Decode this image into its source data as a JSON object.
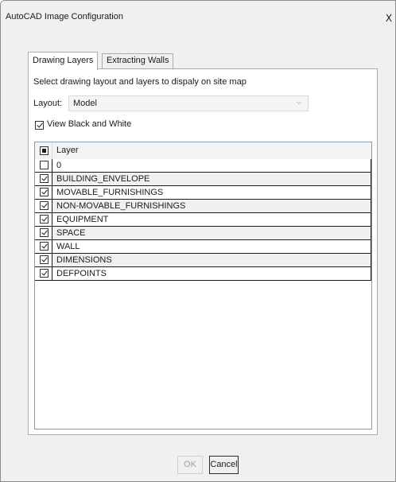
{
  "window": {
    "title": "AutoCAD Image Configuration",
    "close_label": "X"
  },
  "tabs": [
    {
      "label": "Drawing Layers",
      "active": true
    },
    {
      "label": "Extracting Walls",
      "active": false
    }
  ],
  "panel": {
    "instruction": "Select drawing layout and layers to dispaly on site map",
    "layout_label": "Layout:",
    "layout_value": "Model",
    "view_bw_label": "View Black and White",
    "view_bw_checked": true
  },
  "grid": {
    "header_label": "Layer",
    "header_checkbox": "indeterminate",
    "layers": [
      {
        "name": "0",
        "checked": false
      },
      {
        "name": "BUILDING_ENVELOPE",
        "checked": true
      },
      {
        "name": "MOVABLE_FURNISHINGS",
        "checked": true
      },
      {
        "name": "NON-MOVABLE_FURNISHINGS",
        "checked": true
      },
      {
        "name": "EQUIPMENT",
        "checked": true
      },
      {
        "name": "SPACE",
        "checked": true
      },
      {
        "name": "WALL",
        "checked": true
      },
      {
        "name": "DIMENSIONS",
        "checked": true
      },
      {
        "name": "DEFPOINTS",
        "checked": true
      }
    ]
  },
  "buttons": {
    "ok_label": "OK",
    "ok_enabled": false,
    "cancel_label": "Cancel"
  },
  "icons": {
    "close": "close-icon",
    "dropdown": "chevron-down-icon",
    "checkbox": "checkbox-icon"
  }
}
